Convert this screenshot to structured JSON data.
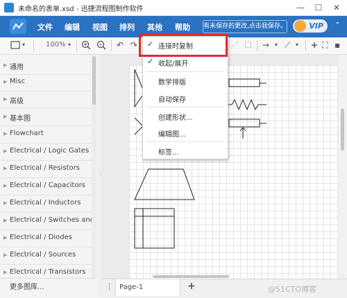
{
  "window": {
    "title": "未命名的表单.xsd - 迅捷流程图制作软件",
    "controls": [
      "—",
      "☐",
      "✕"
    ]
  },
  "menubar": {
    "logo_icon": "flow-logo-icon",
    "items": [
      "文件",
      "编辑",
      "视图",
      "排列",
      "其他",
      "帮助"
    ],
    "unsaved_notice": "有未保存的更改,点击我保存。",
    "vip_label": "VIP",
    "collapse_glyph": "⌃"
  },
  "toolbar": {
    "zoom": "100%",
    "icons": [
      "page-view-icon",
      "dropdown-icon",
      "zoom-in-icon",
      "zoom-out-icon",
      "undo-icon",
      "connector-icon",
      "waypoint-icon",
      "insert-icon",
      "fit-icon"
    ]
  },
  "sidebar": {
    "categories": [
      "通用",
      "Misc",
      "高级",
      "基本图",
      "Flowchart",
      "Electrical / Logic Gates",
      "Electrical / Resistors",
      "Electrical / Capacitors",
      "Electrical / Inductors",
      "Electrical / Switches and ...",
      "Electrical / Diodes",
      "Electrical / Sources",
      "Electrical / Transistors"
    ],
    "more_libraries": "更多图库..."
  },
  "dropdown": {
    "items": [
      {
        "label": "连接时复制",
        "checked": true,
        "highlighted": true
      },
      {
        "label": "收起/展开",
        "checked": true
      },
      {
        "label": "数学排版",
        "checked": false
      },
      {
        "label": "自动保存",
        "checked": false
      },
      {
        "label": "创建形状...",
        "checked": false
      },
      {
        "label": "编辑图...",
        "checked": false
      },
      {
        "label": "标签...",
        "checked": false
      }
    ],
    "check_glyph": "✓"
  },
  "pages": {
    "tab_label": "Page-1",
    "menu_glyph": "⋮",
    "add_glyph": "+"
  },
  "watermark": "@51CTO博客",
  "colors": {
    "menubar": "#2b72c2",
    "highlight": "#e02b2b"
  }
}
